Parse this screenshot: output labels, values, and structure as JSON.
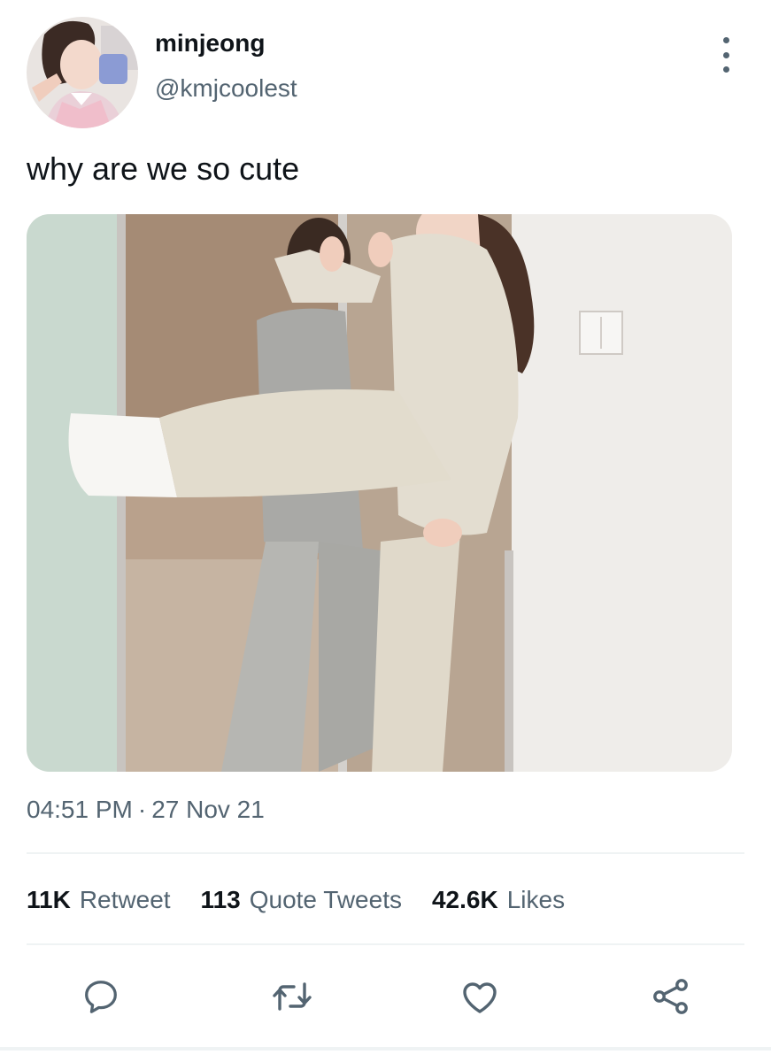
{
  "author": {
    "display_name": "minjeong",
    "handle": "@kmjcoolest"
  },
  "tweet": {
    "text": "why are we so cute",
    "time": "04:51 PM",
    "separator": "·",
    "date": "27 Nov 21"
  },
  "stats": [
    {
      "count": "11K",
      "label": "Retweet"
    },
    {
      "count": "113",
      "label": "Quote Tweets"
    },
    {
      "count": "42.6K",
      "label": "Likes"
    }
  ],
  "icons": {
    "more": "more-vertical-icon",
    "reply": "reply-icon",
    "retweet": "retweet-icon",
    "like": "heart-icon",
    "share": "share-icon"
  },
  "colors": {
    "primary_text": "#0f1419",
    "secondary_text": "#536471",
    "divider": "#eff3f4"
  }
}
